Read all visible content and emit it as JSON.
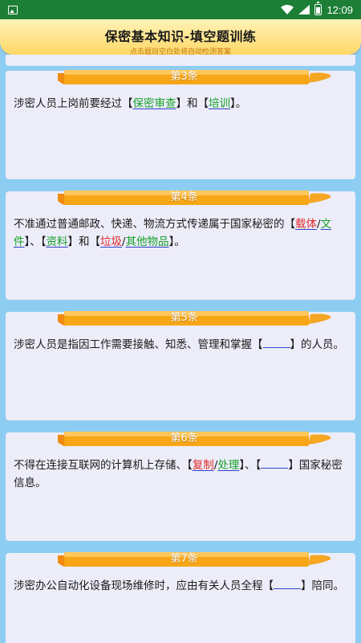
{
  "status_bar": {
    "time": "12:09"
  },
  "header": {
    "title": "保密基本知识-填空题训练",
    "subtitle": "点击题目空白处将自动检测答案"
  },
  "colors": {
    "status_bar": "#1d7e36",
    "ribbon": "#f7a616",
    "answer_green": "#16a12a",
    "answer_red": "#e12b2b",
    "underline": "#3341c9",
    "card": "#ecedf8",
    "background": "#8ecdf2"
  },
  "cards": [
    {
      "label": "第3条",
      "segments": [
        {
          "t": "涉密人员上岗前要经过【"
        },
        {
          "a": "保密审查",
          "c": "green"
        },
        {
          "t": "】和【"
        },
        {
          "a": "培训",
          "c": "green"
        },
        {
          "t": "】。"
        }
      ]
    },
    {
      "label": "第4条",
      "segments": [
        {
          "t": "不准通过普通邮政、快递、物流方式传递属于国家秘密的【"
        },
        {
          "a": "载体",
          "c": "red"
        },
        {
          "t": "/"
        },
        {
          "a": "文件",
          "c": "green"
        },
        {
          "t": "】、【"
        },
        {
          "a": "资料",
          "c": "green"
        },
        {
          "t": "】和【"
        },
        {
          "a": "垃圾",
          "c": "red"
        },
        {
          "t": "/"
        },
        {
          "a": "其他物品",
          "c": "green"
        },
        {
          "t": "】。"
        }
      ]
    },
    {
      "label": "第5条",
      "segments": [
        {
          "t": "涉密人员是指因工作需要接触、知悉、管理和掌握【"
        },
        {
          "blank": true
        },
        {
          "t": "】的人员。"
        }
      ]
    },
    {
      "label": "第6条",
      "segments": [
        {
          "t": "不得在连接互联网的计算机上存储、【"
        },
        {
          "a": "复制",
          "c": "red"
        },
        {
          "t": "/"
        },
        {
          "a": "处理",
          "c": "green"
        },
        {
          "t": "】、【"
        },
        {
          "blank": true
        },
        {
          "t": "】国家秘密信息。"
        }
      ]
    },
    {
      "label": "第7条",
      "segments": [
        {
          "t": "涉密办公自动化设备现场维修时，应由有关人员全程【"
        },
        {
          "blank": true
        },
        {
          "t": "】陪同。"
        }
      ]
    }
  ]
}
